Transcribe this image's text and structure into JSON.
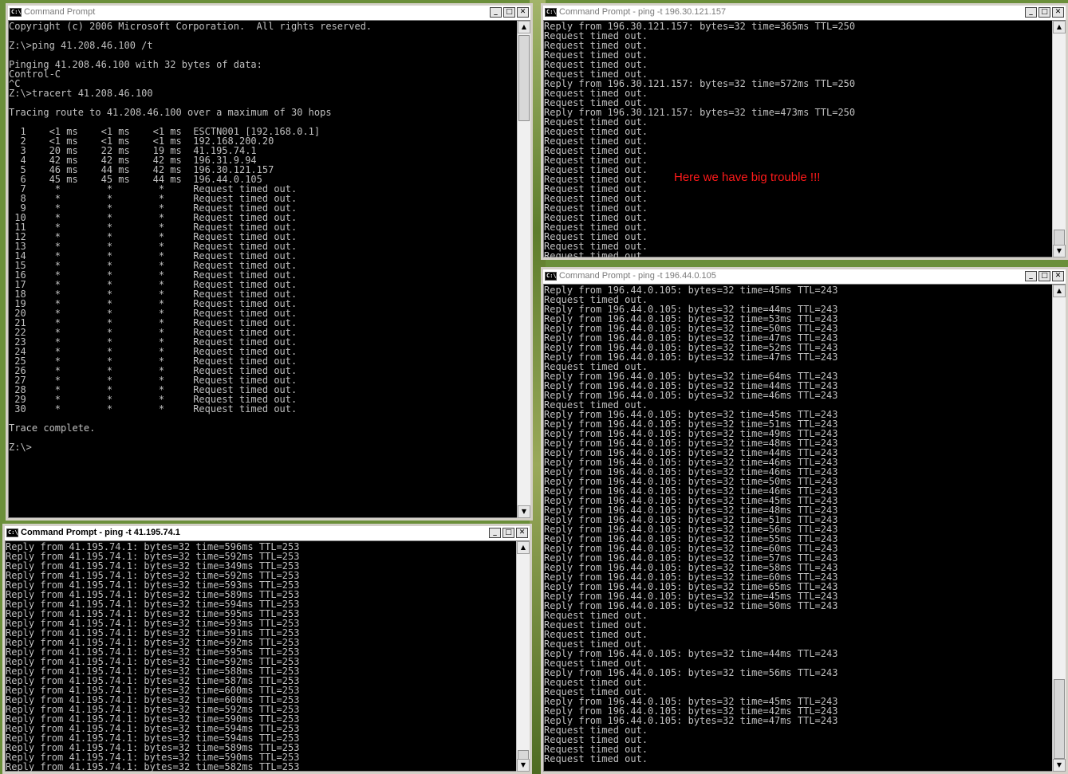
{
  "windows": {
    "main": {
      "title": "Command Prompt",
      "lines": [
        "Copyright (c) 2006 Microsoft Corporation.  All rights reserved.",
        "",
        "Z:\\>ping 41.208.46.100 /t",
        "",
        "Pinging 41.208.46.100 with 32 bytes of data:",
        "Control-C",
        "^C",
        "Z:\\>tracert 41.208.46.100",
        "",
        "Tracing route to 41.208.46.100 over a maximum of 30 hops",
        "",
        "  1    <1 ms    <1 ms    <1 ms  ESCTN001 [192.168.0.1]",
        "  2    <1 ms    <1 ms    <1 ms  192.168.200.20",
        "  3    20 ms    22 ms    19 ms  41.195.74.1",
        "  4    42 ms    42 ms    42 ms  196.31.9.94",
        "  5    46 ms    44 ms    42 ms  196.30.121.157",
        "  6    45 ms    45 ms    44 ms  196.44.0.105",
        "  7     *        *        *     Request timed out.",
        "  8     *        *        *     Request timed out.",
        "  9     *        *        *     Request timed out.",
        " 10     *        *        *     Request timed out.",
        " 11     *        *        *     Request timed out.",
        " 12     *        *        *     Request timed out.",
        " 13     *        *        *     Request timed out.",
        " 14     *        *        *     Request timed out.",
        " 15     *        *        *     Request timed out.",
        " 16     *        *        *     Request timed out.",
        " 17     *        *        *     Request timed out.",
        " 18     *        *        *     Request timed out.",
        " 19     *        *        *     Request timed out.",
        " 20     *        *        *     Request timed out.",
        " 21     *        *        *     Request timed out.",
        " 22     *        *        *     Request timed out.",
        " 23     *        *        *     Request timed out.",
        " 24     *        *        *     Request timed out.",
        " 25     *        *        *     Request timed out.",
        " 26     *        *        *     Request timed out.",
        " 27     *        *        *     Request timed out.",
        " 28     *        *        *     Request timed out.",
        " 29     *        *        *     Request timed out.",
        " 30     *        *        *     Request timed out.",
        "",
        "Trace complete.",
        "",
        "Z:\\>"
      ]
    },
    "ping_hop5": {
      "title": "Command Prompt - ping  -t 196.30.121.157",
      "lines": [
        "Reply from 196.30.121.157: bytes=32 time=365ms TTL=250",
        "Request timed out.",
        "Request timed out.",
        "Request timed out.",
        "Request timed out.",
        "Request timed out.",
        "Reply from 196.30.121.157: bytes=32 time=572ms TTL=250",
        "Request timed out.",
        "Request timed out.",
        "Reply from 196.30.121.157: bytes=32 time=473ms TTL=250",
        "Request timed out.",
        "Request timed out.",
        "Request timed out.",
        "Request timed out.",
        "Request timed out.",
        "Request timed out.",
        "Request timed out.",
        "Request timed out.",
        "Request timed out.",
        "Request timed out.",
        "Request timed out.",
        "Request timed out.",
        "Request timed out.",
        "Request timed out.",
        "Request timed out."
      ],
      "annotation": "Here we have big trouble !!!"
    },
    "ping_hop6": {
      "title": "Command Prompt - ping  -t 196.44.0.105",
      "lines": [
        "Reply from 196.44.0.105: bytes=32 time=45ms TTL=243",
        "Request timed out.",
        "Reply from 196.44.0.105: bytes=32 time=44ms TTL=243",
        "Reply from 196.44.0.105: bytes=32 time=53ms TTL=243",
        "Reply from 196.44.0.105: bytes=32 time=50ms TTL=243",
        "Reply from 196.44.0.105: bytes=32 time=47ms TTL=243",
        "Reply from 196.44.0.105: bytes=32 time=52ms TTL=243",
        "Reply from 196.44.0.105: bytes=32 time=47ms TTL=243",
        "Request timed out.",
        "Reply from 196.44.0.105: bytes=32 time=64ms TTL=243",
        "Reply from 196.44.0.105: bytes=32 time=44ms TTL=243",
        "Reply from 196.44.0.105: bytes=32 time=46ms TTL=243",
        "Request timed out.",
        "Reply from 196.44.0.105: bytes=32 time=45ms TTL=243",
        "Reply from 196.44.0.105: bytes=32 time=51ms TTL=243",
        "Reply from 196.44.0.105: bytes=32 time=49ms TTL=243",
        "Reply from 196.44.0.105: bytes=32 time=48ms TTL=243",
        "Reply from 196.44.0.105: bytes=32 time=44ms TTL=243",
        "Reply from 196.44.0.105: bytes=32 time=46ms TTL=243",
        "Reply from 196.44.0.105: bytes=32 time=46ms TTL=243",
        "Reply from 196.44.0.105: bytes=32 time=50ms TTL=243",
        "Reply from 196.44.0.105: bytes=32 time=46ms TTL=243",
        "Reply from 196.44.0.105: bytes=32 time=45ms TTL=243",
        "Reply from 196.44.0.105: bytes=32 time=48ms TTL=243",
        "Reply from 196.44.0.105: bytes=32 time=51ms TTL=243",
        "Reply from 196.44.0.105: bytes=32 time=56ms TTL=243",
        "Reply from 196.44.0.105: bytes=32 time=55ms TTL=243",
        "Reply from 196.44.0.105: bytes=32 time=60ms TTL=243",
        "Reply from 196.44.0.105: bytes=32 time=57ms TTL=243",
        "Reply from 196.44.0.105: bytes=32 time=58ms TTL=243",
        "Reply from 196.44.0.105: bytes=32 time=60ms TTL=243",
        "Reply from 196.44.0.105: bytes=32 time=65ms TTL=243",
        "Reply from 196.44.0.105: bytes=32 time=45ms TTL=243",
        "Reply from 196.44.0.105: bytes=32 time=50ms TTL=243",
        "Request timed out.",
        "Request timed out.",
        "Request timed out.",
        "Request timed out.",
        "Reply from 196.44.0.105: bytes=32 time=44ms TTL=243",
        "Request timed out.",
        "Reply from 196.44.0.105: bytes=32 time=56ms TTL=243",
        "Request timed out.",
        "Request timed out.",
        "Reply from 196.44.0.105: bytes=32 time=45ms TTL=243",
        "Reply from 196.44.0.105: bytes=32 time=42ms TTL=243",
        "Reply from 196.44.0.105: bytes=32 time=47ms TTL=243",
        "Request timed out.",
        "Request timed out.",
        "Request timed out.",
        "Request timed out."
      ]
    },
    "ping_hop3": {
      "title": "Command Prompt - ping  -t 41.195.74.1",
      "lines": [
        "Reply from 41.195.74.1: bytes=32 time=596ms TTL=253",
        "Reply from 41.195.74.1: bytes=32 time=592ms TTL=253",
        "Reply from 41.195.74.1: bytes=32 time=349ms TTL=253",
        "Reply from 41.195.74.1: bytes=32 time=592ms TTL=253",
        "Reply from 41.195.74.1: bytes=32 time=593ms TTL=253",
        "Reply from 41.195.74.1: bytes=32 time=589ms TTL=253",
        "Reply from 41.195.74.1: bytes=32 time=594ms TTL=253",
        "Reply from 41.195.74.1: bytes=32 time=595ms TTL=253",
        "Reply from 41.195.74.1: bytes=32 time=593ms TTL=253",
        "Reply from 41.195.74.1: bytes=32 time=591ms TTL=253",
        "Reply from 41.195.74.1: bytes=32 time=592ms TTL=253",
        "Reply from 41.195.74.1: bytes=32 time=595ms TTL=253",
        "Reply from 41.195.74.1: bytes=32 time=592ms TTL=253",
        "Reply from 41.195.74.1: bytes=32 time=588ms TTL=253",
        "Reply from 41.195.74.1: bytes=32 time=587ms TTL=253",
        "Reply from 41.195.74.1: bytes=32 time=600ms TTL=253",
        "Reply from 41.195.74.1: bytes=32 time=600ms TTL=253",
        "Reply from 41.195.74.1: bytes=32 time=592ms TTL=253",
        "Reply from 41.195.74.1: bytes=32 time=590ms TTL=253",
        "Reply from 41.195.74.1: bytes=32 time=594ms TTL=253",
        "Reply from 41.195.74.1: bytes=32 time=594ms TTL=253",
        "Reply from 41.195.74.1: bytes=32 time=589ms TTL=253",
        "Reply from 41.195.74.1: bytes=32 time=590ms TTL=253",
        "Reply from 41.195.74.1: bytes=32 time=582ms TTL=253"
      ]
    }
  },
  "buttons": {
    "minimize": "_",
    "restore": "□",
    "close": "✕"
  },
  "icon_text": "C:\\",
  "colors": {
    "console_bg": "#000000",
    "console_fg": "#c0c0c0",
    "annotation": "#ff1a1a"
  }
}
